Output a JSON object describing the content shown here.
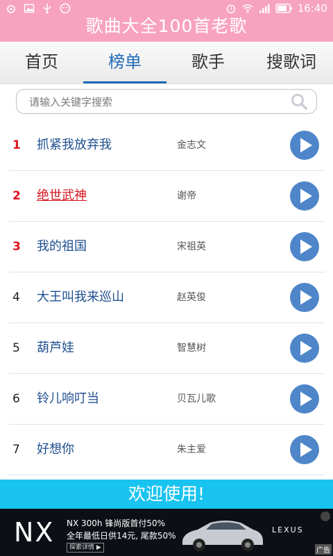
{
  "status_bar": {
    "time": "16:40"
  },
  "app": {
    "title": "歌曲大全100首老歌"
  },
  "tabs": [
    {
      "label": "首页"
    },
    {
      "label": "榜单"
    },
    {
      "label": "歌手"
    },
    {
      "label": "搜歌词"
    }
  ],
  "active_tab": "榜单",
  "search": {
    "placeholder": "请输入关键字搜索"
  },
  "songs": [
    {
      "rank": "1",
      "title": "抓紧我放弃我",
      "artist": "金志文"
    },
    {
      "rank": "2",
      "title": "绝世武神",
      "artist": "谢帝"
    },
    {
      "rank": "3",
      "title": "我的祖国",
      "artist": "宋祖英"
    },
    {
      "rank": "4",
      "title": "大王叫我来巡山",
      "artist": "赵英俊"
    },
    {
      "rank": "5",
      "title": "葫芦娃",
      "artist": "智慧树"
    },
    {
      "rank": "6",
      "title": "铃儿响叮当",
      "artist": "贝瓦儿歌"
    },
    {
      "rank": "7",
      "title": "好想你",
      "artist": "朱主爱"
    }
  ],
  "welcome": {
    "text": "欢迎使用!"
  },
  "ad": {
    "logo": "NX",
    "line1": "NX 300h 锋尚版首付50%",
    "line2": "全年最低日供14元, 尾款50%",
    "button": "探索详情 ▶",
    "brand": "LEXUS",
    "tag": "广告"
  },
  "colors": {
    "header": "#f7a3bf",
    "accent": "#1e6bb8",
    "welcome": "#19c3f0",
    "play": "#4f86c9",
    "top_rank": "#e0141e"
  }
}
